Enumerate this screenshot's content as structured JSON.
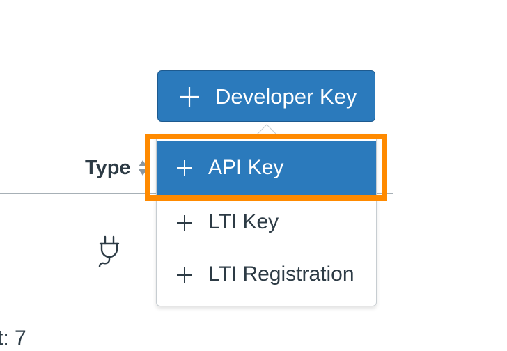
{
  "header": {
    "developer_key_button_label": "Developer Key"
  },
  "table": {
    "type_column_label": "Type",
    "row_type_icon": "plug-icon"
  },
  "dropdown": {
    "items": [
      {
        "label": "API Key",
        "icon": "plus-icon",
        "highlighted": true
      },
      {
        "label": "LTI Key",
        "icon": "plus-icon"
      },
      {
        "label": "LTI Registration",
        "icon": "plus-icon"
      }
    ]
  },
  "footer": {
    "count_text": "t: 7"
  },
  "colors": {
    "primary": "#2b7abc",
    "highlight": "#ff8a00",
    "text": "#2d3b45",
    "divider": "#a7b0b6"
  }
}
